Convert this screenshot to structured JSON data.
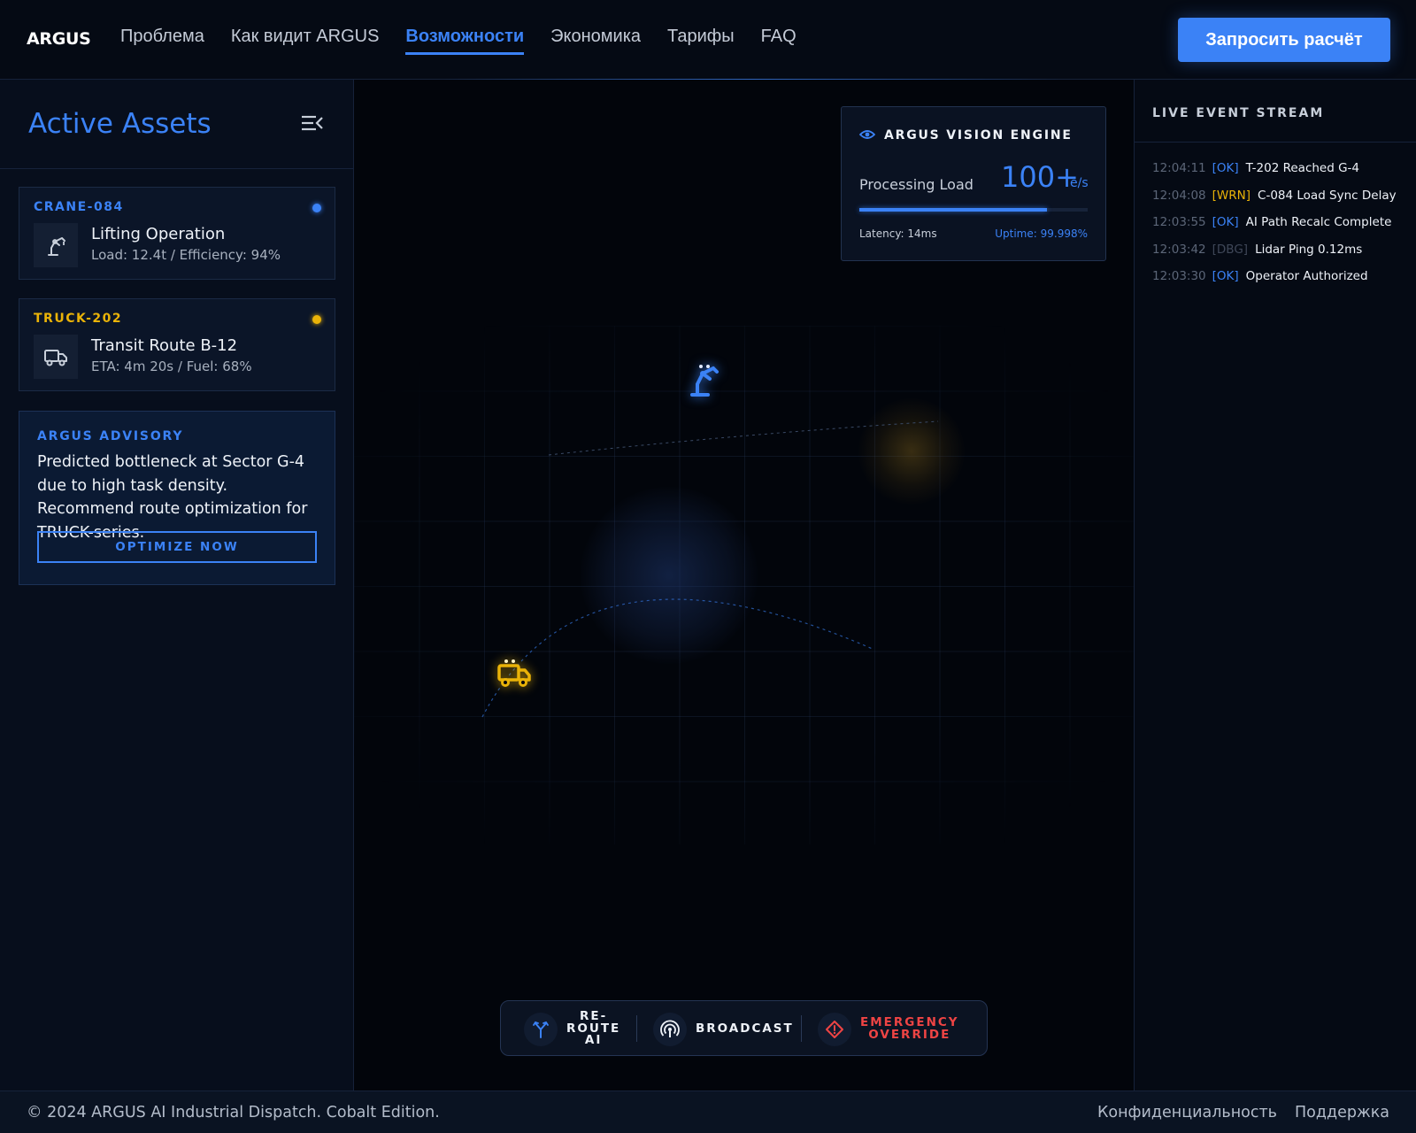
{
  "brand": "ARGUS",
  "nav": {
    "items": [
      {
        "label": "Проблема",
        "active": false
      },
      {
        "label": "Как видит ARGUS",
        "active": false
      },
      {
        "label": "Возможности",
        "active": true
      },
      {
        "label": "Экономика",
        "active": false
      },
      {
        "label": "Тарифы",
        "active": false
      },
      {
        "label": "FAQ",
        "active": false
      }
    ],
    "cta_label": "Запросить расчёт"
  },
  "colors": {
    "accent": "#3b82f6",
    "warn": "#eab308",
    "danger": "#ef4444",
    "ok": "#3b82f6",
    "dbg": "#3f4758"
  },
  "left_panel": {
    "title": "Active Assets",
    "collapse_icon": "collapse-menu-icon",
    "assets": [
      {
        "code": "CRANE-084",
        "name": "Lifting Operation",
        "meta": "Load: 12.4t / Efficiency: 94%",
        "status_color": "#3b82f6",
        "icon": "crane-icon"
      },
      {
        "code": "TRUCK-202",
        "name": "Transit Route B-12",
        "meta": "ETA: 4m 20s / Fuel: 68%",
        "status_color": "#eab308",
        "icon": "truck-icon"
      }
    ],
    "advisory": {
      "label": "ARGUS ADVISORY",
      "text": "Predicted bottleneck at Sector G-4 due to high task density. Recommend route optimization for TRUCK-series.",
      "button": "OPTIMIZE NOW"
    }
  },
  "engine": {
    "title": "ARGUS VISION ENGINE",
    "processing_label": "Processing Load",
    "value": "100+",
    "unit": "e/s",
    "load_fraction": 0.82,
    "latency": "Latency: 14ms",
    "uptime": "Uptime: 99.998%"
  },
  "actions": [
    {
      "label": "RE-\nROUTE\nAI",
      "icon": "route-split-icon",
      "color": "#eef2f8",
      "icon_color": "#3b82f6"
    },
    {
      "label": "BROADCAST",
      "icon": "broadcast-icon",
      "color": "#eef2f8",
      "icon_color": "#eef2f8"
    },
    {
      "label": "EMERGENCY\nOVERRIDE",
      "icon": "emergency-diamond-icon",
      "color": "#ef4444",
      "icon_color": "#ef4444"
    }
  ],
  "event_stream": {
    "title": "LIVE EVENT STREAM",
    "events": [
      {
        "time": "12:04:11",
        "level": "[OK]",
        "level_color": "#3b82f6",
        "message": "T-202 Reached G-4"
      },
      {
        "time": "12:04:08",
        "level": "[WRN]",
        "level_color": "#eab308",
        "message": "C-084 Load Sync Delay"
      },
      {
        "time": "12:03:55",
        "level": "[OK]",
        "level_color": "#3b82f6",
        "message": "AI Path Recalc Complete"
      },
      {
        "time": "12:03:42",
        "level": "[DBG]",
        "level_color": "#3f4758",
        "message": "Lidar Ping 0.12ms"
      },
      {
        "time": "12:03:30",
        "level": "[OK]",
        "level_color": "#3b82f6",
        "message": "Operator Authorized"
      }
    ]
  },
  "footer": {
    "copyright": "© 2024 ARGUS AI Industrial Dispatch. Cobalt Edition.",
    "links": [
      "Конфиденциальность",
      "Поддержка"
    ]
  }
}
